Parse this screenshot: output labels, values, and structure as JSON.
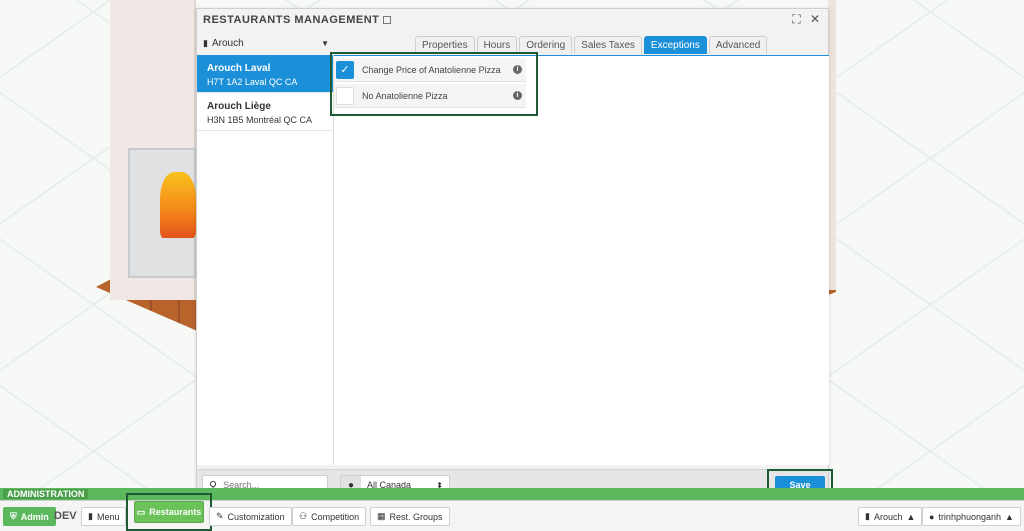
{
  "window": {
    "title": "RESTAURANTS MANAGEMENT",
    "controls": {
      "expand": "⛶",
      "close": "✕"
    }
  },
  "restaurant_selector": {
    "value": "Arouch"
  },
  "sidebar": {
    "items": [
      {
        "name": "Arouch Laval",
        "address": "H7T 1A2 Laval QC CA",
        "active": true
      },
      {
        "name": "Arouch Liège",
        "address": "H3N 1B5 Montréal QC CA",
        "active": false
      }
    ]
  },
  "tabs": [
    {
      "label": "Properties",
      "active": false
    },
    {
      "label": "Hours",
      "active": false
    },
    {
      "label": "Ordering",
      "active": false
    },
    {
      "label": "Sales Taxes",
      "active": false
    },
    {
      "label": "Exceptions",
      "active": true
    },
    {
      "label": "Advanced",
      "active": false
    }
  ],
  "exceptions": [
    {
      "label": "Change Price of Anatolienne Pizza",
      "checked": true
    },
    {
      "label": "No Anatolienne Pizza",
      "checked": false
    }
  ],
  "footer": {
    "search_placeholder": "Search...",
    "region": "All Canada",
    "save_label": "Save"
  },
  "admin_bar": {
    "section_label": "ADMINISTRATION",
    "admin_label": "Admin",
    "env_label": "DEV",
    "menu_label": "Menu",
    "restaurants_label": "Restaurants",
    "customization_label": "Customization",
    "competition_label": "Competition",
    "rest_groups_label": "Rest. Groups",
    "restaurant_menu_label": "Arouch",
    "user_label": "trinhphuonganh"
  },
  "colors": {
    "accent": "#1c8fd9",
    "admin_green": "#5cb85c",
    "highlight_border": "#1e5a34"
  }
}
